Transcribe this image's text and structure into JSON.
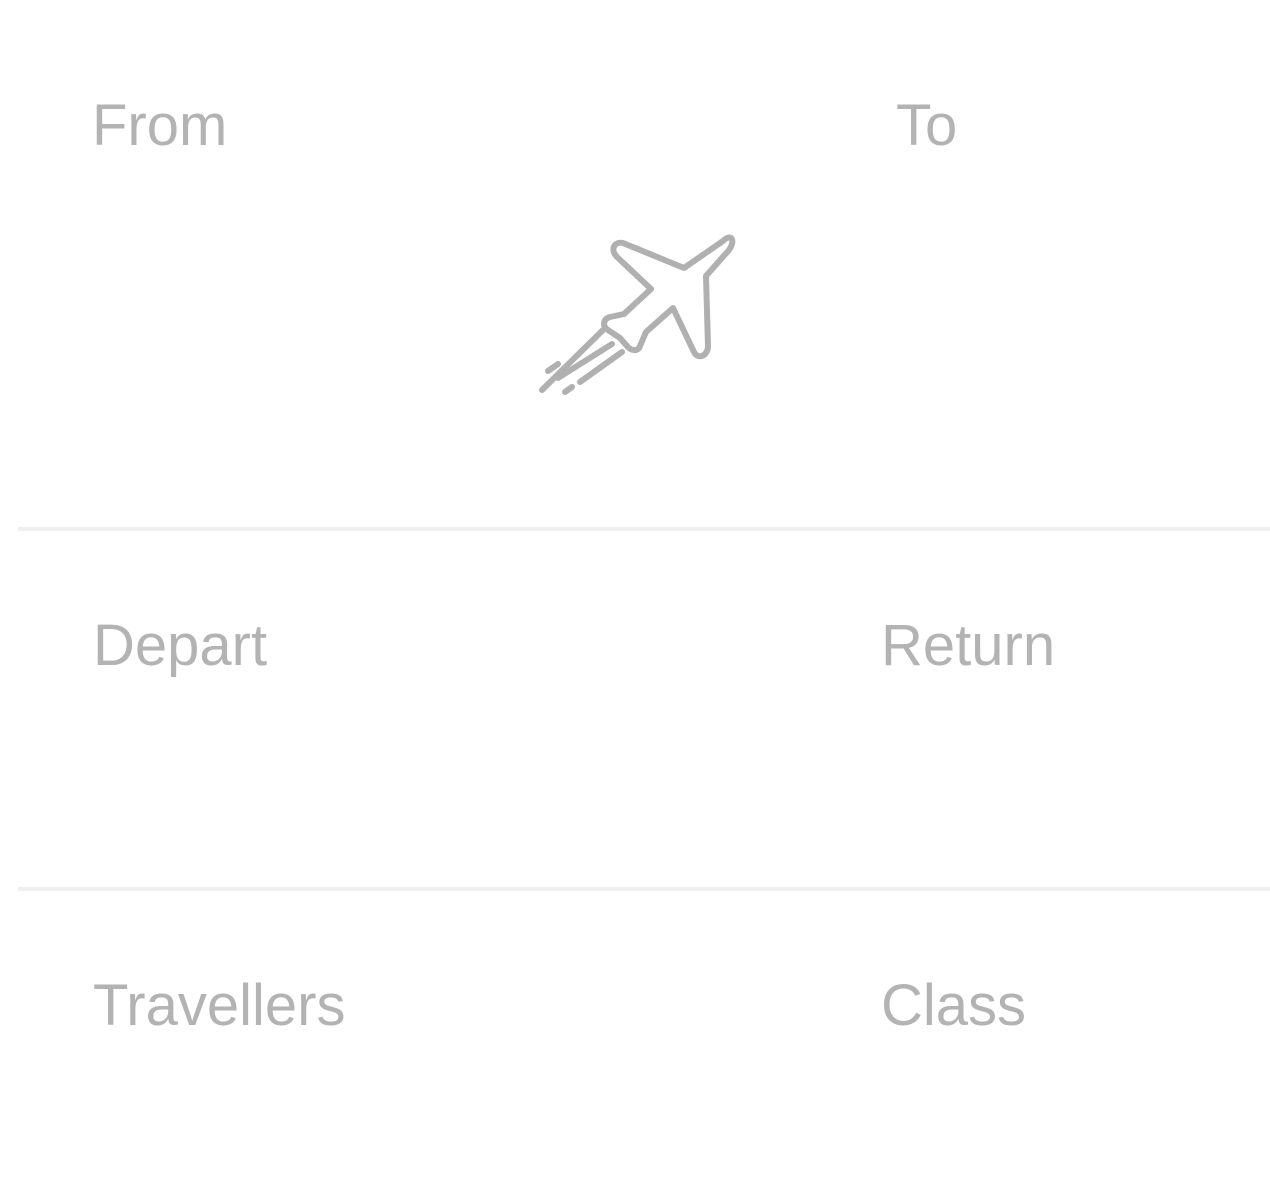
{
  "route": {
    "from": {
      "label": "From",
      "value": ""
    },
    "to": {
      "label": "To",
      "value": ""
    },
    "swap_icon": "airplane-takeoff-icon"
  },
  "dates": {
    "depart": {
      "label": "Depart",
      "value": ""
    },
    "return": {
      "label": "Return",
      "value": ""
    }
  },
  "options": {
    "travellers": {
      "label": "Travellers",
      "value": ""
    },
    "class": {
      "label": "Class",
      "value": ""
    }
  },
  "colors": {
    "label": "#b3b3b3",
    "icon": "#b0b0b0",
    "divider": "#efefef",
    "background": "#ffffff"
  }
}
